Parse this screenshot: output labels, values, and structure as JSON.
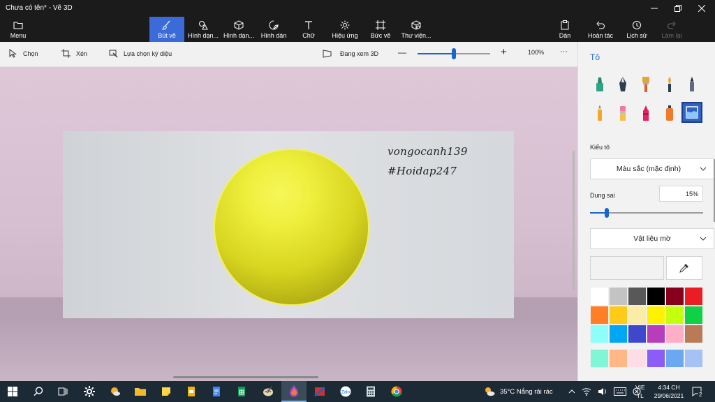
{
  "window": {
    "title": "Chưa có tên* - Vẽ 3D",
    "controls": [
      "minimize",
      "restore",
      "close"
    ]
  },
  "ribbon": {
    "menu": "Menu",
    "tools": [
      {
        "label": "Bút vẽ",
        "icon": "brush-icon",
        "active": true
      },
      {
        "label": "Hình dạn...",
        "icon": "2d-shapes-icon"
      },
      {
        "label": "Hình dạn...",
        "icon": "3d-shapes-icon"
      },
      {
        "label": "Hình dán",
        "icon": "sticker-icon"
      },
      {
        "label": "Chữ",
        "icon": "text-icon"
      },
      {
        "label": "Hiệu ứng",
        "icon": "effects-icon"
      },
      {
        "label": "Bức vẽ",
        "icon": "canvas-icon"
      },
      {
        "label": "Thư viện...",
        "icon": "library-icon"
      }
    ],
    "right": [
      {
        "label": "Dán",
        "icon": "paste-icon"
      },
      {
        "label": "Hoàn tác",
        "icon": "undo-icon"
      },
      {
        "label": "Lịch sử",
        "icon": "history-icon"
      },
      {
        "label": "Làm lại",
        "icon": "redo-icon",
        "disabled": true
      }
    ]
  },
  "toolbar": {
    "select": "Chọn",
    "crop": "Xén",
    "magic_select": "Lựa chọn kỳ diệu",
    "view3d": "Đang xem 3D",
    "zoom_minus": "—",
    "zoom_plus": "+",
    "zoom": "100%",
    "more": "···",
    "zoom_level": 0.3
  },
  "canvas": {
    "note_line1": "vongocanh139",
    "note_line2": "#Hoidap247",
    "object_color": "#e8e838"
  },
  "panel": {
    "title": "Tô",
    "brushes": [
      "marker",
      "calligraphy-pen",
      "oil-brush",
      "watercolor",
      "pixel-pen",
      "pencil",
      "eraser",
      "crayon",
      "spray-can",
      "fill"
    ],
    "selected_brush": "fill",
    "fill_type_label": "Kiểu tô",
    "fill_type_value": "Màu sắc (mặc định)",
    "tolerance_label": "Dung sai",
    "tolerance_value": "15%",
    "tolerance_fraction": 0.15,
    "material_value": "Vật liệu mờ",
    "palette_row1": [
      "#ffffff",
      "#c3c3c3",
      "#585858",
      "#000000",
      "#88001b",
      "#ec1c24"
    ],
    "palette_row2": [
      "#ff7f27",
      "#ffca18",
      "#fdeca6",
      "#fff200",
      "#c4ff0e",
      "#0ed145"
    ],
    "palette_row3": [
      "#8cfffb",
      "#00a8f3",
      "#3f48cc",
      "#b83dba",
      "#ffaec8",
      "#b97a56"
    ],
    "palette_row4": [
      "#7ff7d6",
      "#ffb885",
      "#ffdde6",
      "#8b5cf6",
      "#6aa8f0",
      "#a4c2f4"
    ]
  },
  "taskbar": {
    "apps": [
      "windows-start-icon",
      "search-icon",
      "task-view-icon",
      "settings-icon",
      "weather-app-icon",
      "file-explorer-icon",
      "sticky-notes-icon",
      "slides-icon",
      "docs-icon",
      "sheets-icon",
      "paint-icon",
      "paint3d-icon",
      "red-app-icon",
      "zalo-icon",
      "calculator-icon",
      "chrome-icon"
    ],
    "weather": "35°C  Nắng rải rác",
    "lang_top": "VIE",
    "lang_bottom": "TL",
    "time": "4:34 CH",
    "date": "29/06/2021",
    "notifications": "2"
  }
}
